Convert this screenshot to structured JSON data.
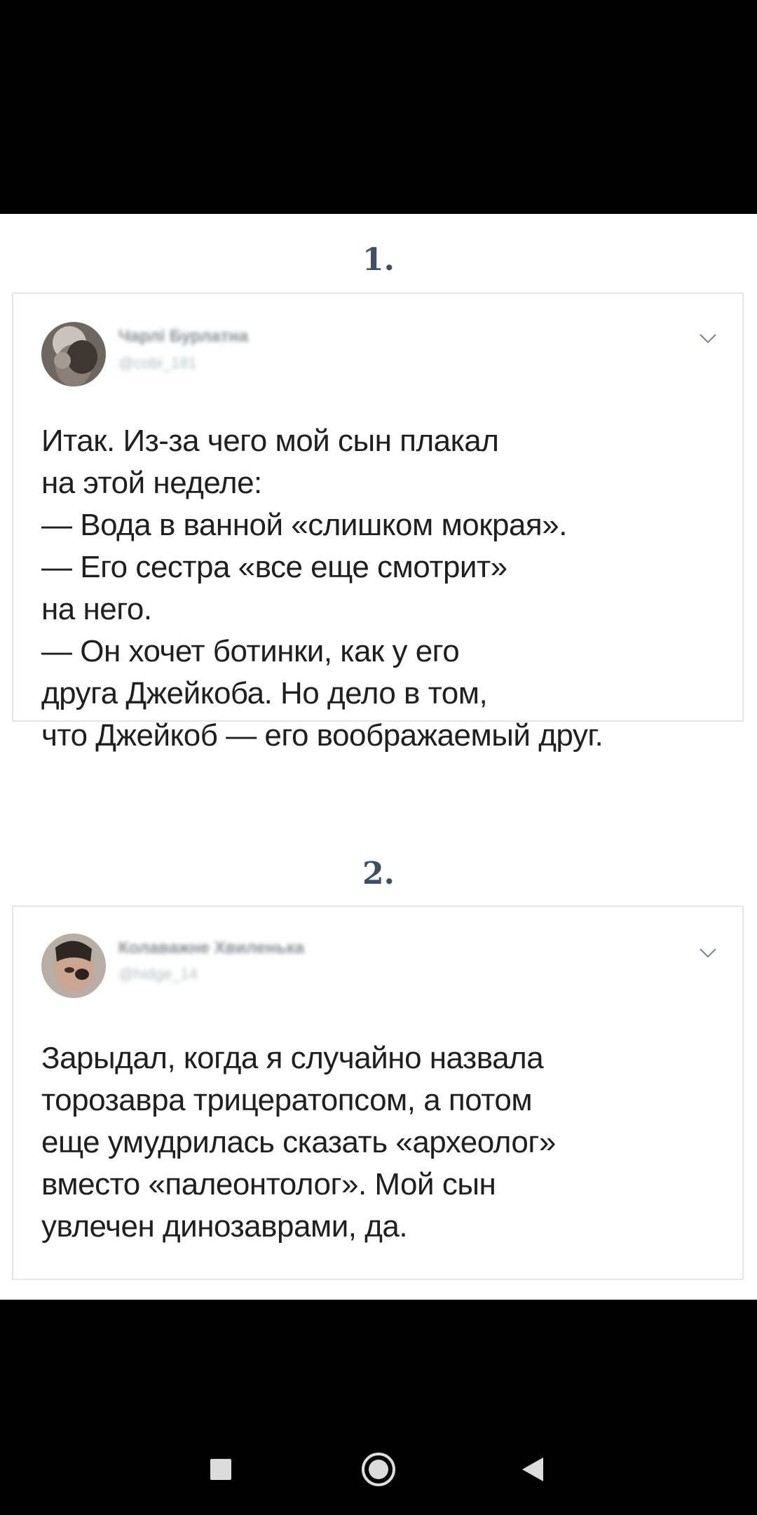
{
  "posts": [
    {
      "number": "1.",
      "author_name": "Чарлі Бурлатна",
      "author_handle": "@cobi_181",
      "text": "Итак. Из-за чего мой сын плакал\nна этой неделе:\n— Вода в ванной «слишком мокрая».\n— Его сестра «все еще смотрит»\nна него.\n— Он хочет ботинки, как у его\nдруга Джейкоба. Но дело в том,\nчто Джейкоб — его воображаемый друг.",
      "menu_icon": "chevron-down-icon"
    },
    {
      "number": "2.",
      "author_name": "Колаважне Хвиленька",
      "author_handle": "@hidge_14",
      "text": "Зарыдал, когда я случайно назвала\nторозавра трицератопсом, а потом\nеще умудрилась сказать «археолог»\nвместо «палеонтолог». Мой сын\nувлечен динозаврами, да.",
      "menu_icon": "chevron-down-icon"
    }
  ],
  "navigation": {
    "buttons": [
      "recent-apps",
      "home",
      "back"
    ]
  },
  "colors": {
    "number": "#3f4f63",
    "card_border": "#e3e6ea",
    "text": "#1f1f1f"
  }
}
